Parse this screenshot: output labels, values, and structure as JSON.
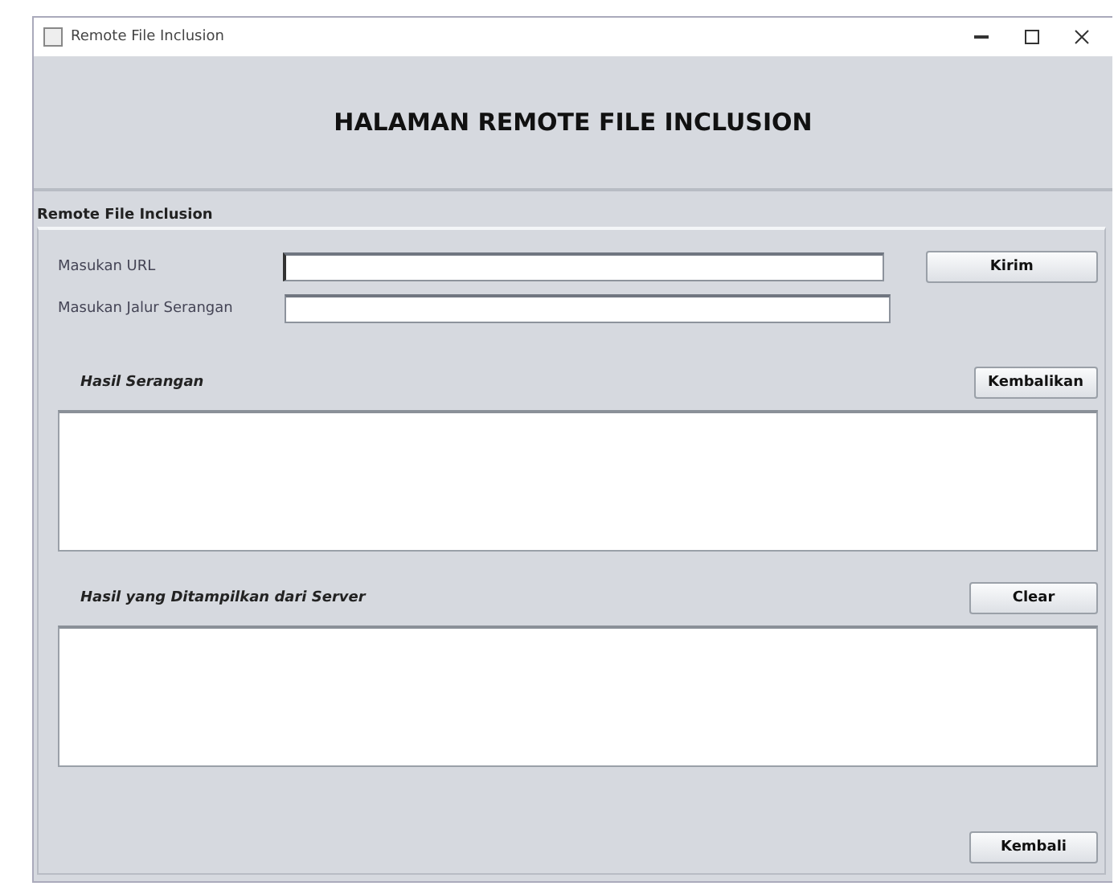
{
  "window": {
    "title": "Remote File Inclusion"
  },
  "header": {
    "title": "HALAMAN REMOTE FILE INCLUSION"
  },
  "panel": {
    "title": "Remote File Inclusion"
  },
  "fields": [
    {
      "label": "Masukan URL",
      "focused": true
    },
    {
      "label": "Masukan Jalur Serangan",
      "focused": false
    }
  ],
  "send_button": "Kirim",
  "result": {
    "label": "Hasil Serangan",
    "button": "Kembalikan"
  },
  "output": {
    "label": "Hasil yang Ditampilkan dari Server",
    "button": "Clear"
  },
  "back_button": "Kembali"
}
